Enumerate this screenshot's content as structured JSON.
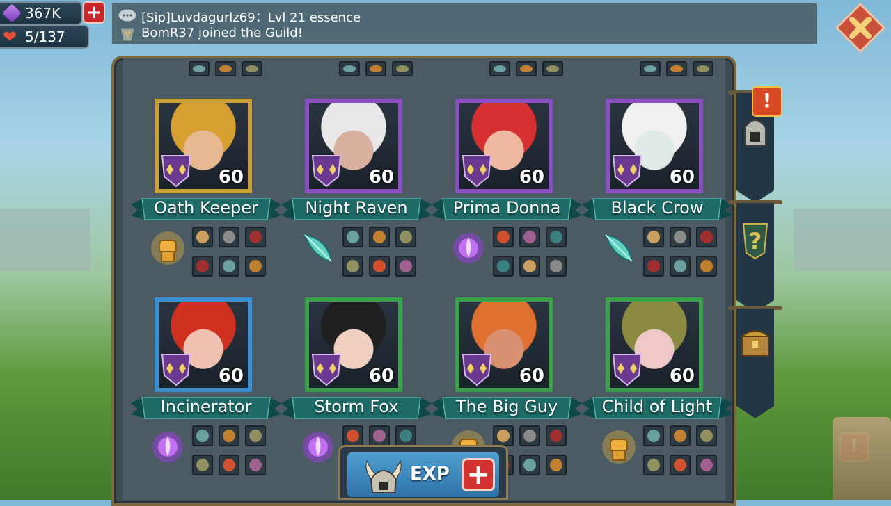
{
  "resources": {
    "gems": "367K",
    "stamina": "5/137"
  },
  "chat": {
    "line1": "[Sip]Luvdagurlz69：Lvl 21 essence",
    "line2": "BomR37 joined the Guild!"
  },
  "heroes": [
    {
      "name": "Oath Keeper",
      "level": "60",
      "rarity_color": "#c9a13a",
      "class_icon": "fist-icon"
    },
    {
      "name": "Night Raven",
      "level": "60",
      "rarity_color": "#8a4fc0",
      "class_icon": "feather-icon"
    },
    {
      "name": "Prima Donna",
      "level": "60",
      "rarity_color": "#8a4fc0",
      "class_icon": "magic-orb-icon"
    },
    {
      "name": "Black Crow",
      "level": "60",
      "rarity_color": "#8a4fc0",
      "class_icon": "feather-icon"
    },
    {
      "name": "Incinerator",
      "level": "60",
      "rarity_color": "#3a8fd0",
      "class_icon": "magic-orb-icon"
    },
    {
      "name": "Storm Fox",
      "level": "60",
      "rarity_color": "#3aa04a",
      "class_icon": "magic-orb-icon"
    },
    {
      "name": "The Big Guy",
      "level": "60",
      "rarity_color": "#3aa04a",
      "class_icon": "fist-icon"
    },
    {
      "name": "Child of Light",
      "level": "60",
      "rarity_color": "#3aa04a",
      "class_icon": "fist-icon"
    }
  ],
  "exp_button": {
    "label": "EXP"
  },
  "colors": {
    "banner": "#1d6a66",
    "panel": "#4b5a63",
    "close": "#c9503a"
  }
}
